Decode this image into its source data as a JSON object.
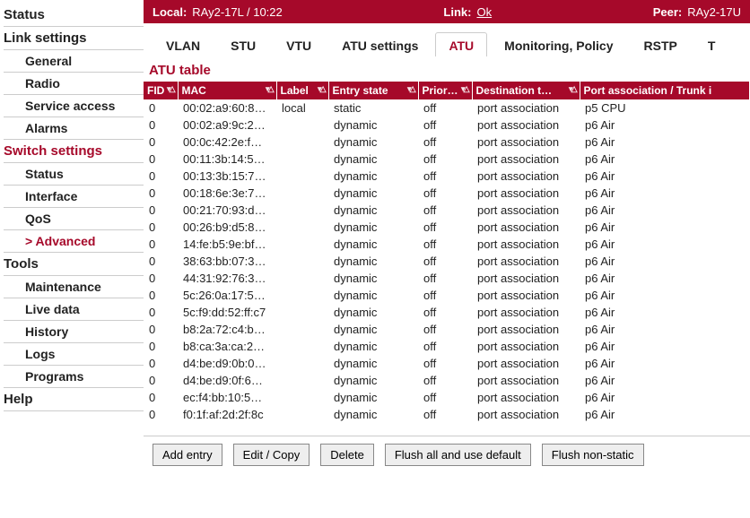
{
  "side": {
    "status": "Status",
    "link_settings": "Link settings",
    "ls": {
      "general": "General",
      "radio": "Radio",
      "service_access": "Service access",
      "alarms": "Alarms"
    },
    "switch_settings": "Switch settings",
    "ss": {
      "status": "Status",
      "interface": "Interface",
      "qos": "QoS",
      "advanced": "Advanced"
    },
    "tools": "Tools",
    "tl": {
      "maintenance": "Maintenance",
      "live_data": "Live data",
      "history": "History",
      "logs": "Logs",
      "programs": "Programs"
    },
    "help": "Help"
  },
  "topbar": {
    "local_lbl": "Local:",
    "local_val": "RAy2-17L / 10:22",
    "link_lbl": "Link:",
    "link_val": "Ok",
    "peer_lbl": "Peer:",
    "peer_val": "RAy2-17U"
  },
  "tabs": {
    "vlan": "VLAN",
    "stu": "STU",
    "vtu": "VTU",
    "atu_settings": "ATU settings",
    "atu": "ATU",
    "monitoring": "Monitoring, Policy",
    "rstp": "RSTP",
    "t": "T"
  },
  "table": {
    "title": "ATU table",
    "headers": {
      "fid": "FID",
      "mac": "MAC",
      "label": "Label",
      "entry": "Entry state",
      "prio": "Prior…",
      "dest": "Destination t…",
      "port": "Port association / Trunk i"
    },
    "sorticon": "▾△",
    "rows": [
      {
        "fid": "0",
        "mac": "00:02:a9:60:8…",
        "label": "local",
        "entry": "static",
        "prio": "off",
        "dest": "port association",
        "port": "p5 CPU"
      },
      {
        "fid": "0",
        "mac": "00:02:a9:9c:2…",
        "label": "",
        "entry": "dynamic",
        "prio": "off",
        "dest": "port association",
        "port": "p6 Air"
      },
      {
        "fid": "0",
        "mac": "00:0c:42:2e:f…",
        "label": "",
        "entry": "dynamic",
        "prio": "off",
        "dest": "port association",
        "port": "p6 Air"
      },
      {
        "fid": "0",
        "mac": "00:11:3b:14:5…",
        "label": "",
        "entry": "dynamic",
        "prio": "off",
        "dest": "port association",
        "port": "p6 Air"
      },
      {
        "fid": "0",
        "mac": "00:13:3b:15:7…",
        "label": "",
        "entry": "dynamic",
        "prio": "off",
        "dest": "port association",
        "port": "p6 Air"
      },
      {
        "fid": "0",
        "mac": "00:18:6e:3e:7…",
        "label": "",
        "entry": "dynamic",
        "prio": "off",
        "dest": "port association",
        "port": "p6 Air"
      },
      {
        "fid": "0",
        "mac": "00:21:70:93:d…",
        "label": "",
        "entry": "dynamic",
        "prio": "off",
        "dest": "port association",
        "port": "p6 Air"
      },
      {
        "fid": "0",
        "mac": "00:26:b9:d5:8…",
        "label": "",
        "entry": "dynamic",
        "prio": "off",
        "dest": "port association",
        "port": "p6 Air"
      },
      {
        "fid": "0",
        "mac": "14:fe:b5:9e:bf…",
        "label": "",
        "entry": "dynamic",
        "prio": "off",
        "dest": "port association",
        "port": "p6 Air"
      },
      {
        "fid": "0",
        "mac": "38:63:bb:07:3…",
        "label": "",
        "entry": "dynamic",
        "prio": "off",
        "dest": "port association",
        "port": "p6 Air"
      },
      {
        "fid": "0",
        "mac": "44:31:92:76:3…",
        "label": "",
        "entry": "dynamic",
        "prio": "off",
        "dest": "port association",
        "port": "p6 Air"
      },
      {
        "fid": "0",
        "mac": "5c:26:0a:17:5…",
        "label": "",
        "entry": "dynamic",
        "prio": "off",
        "dest": "port association",
        "port": "p6 Air"
      },
      {
        "fid": "0",
        "mac": "5c:f9:dd:52:ff:c7",
        "label": "",
        "entry": "dynamic",
        "prio": "off",
        "dest": "port association",
        "port": "p6 Air"
      },
      {
        "fid": "0",
        "mac": "b8:2a:72:c4:b…",
        "label": "",
        "entry": "dynamic",
        "prio": "off",
        "dest": "port association",
        "port": "p6 Air"
      },
      {
        "fid": "0",
        "mac": "b8:ca:3a:ca:2…",
        "label": "",
        "entry": "dynamic",
        "prio": "off",
        "dest": "port association",
        "port": "p6 Air"
      },
      {
        "fid": "0",
        "mac": "d4:be:d9:0b:0…",
        "label": "",
        "entry": "dynamic",
        "prio": "off",
        "dest": "port association",
        "port": "p6 Air"
      },
      {
        "fid": "0",
        "mac": "d4:be:d9:0f:6…",
        "label": "",
        "entry": "dynamic",
        "prio": "off",
        "dest": "port association",
        "port": "p6 Air"
      },
      {
        "fid": "0",
        "mac": "ec:f4:bb:10:5…",
        "label": "",
        "entry": "dynamic",
        "prio": "off",
        "dest": "port association",
        "port": "p6 Air"
      },
      {
        "fid": "0",
        "mac": "f0:1f:af:2d:2f:8c",
        "label": "",
        "entry": "dynamic",
        "prio": "off",
        "dest": "port association",
        "port": "p6 Air"
      }
    ]
  },
  "buttons": {
    "add": "Add entry",
    "edit": "Edit / Copy",
    "del": "Delete",
    "flush_def": "Flush all and use default",
    "flush_ns": "Flush non-static"
  }
}
